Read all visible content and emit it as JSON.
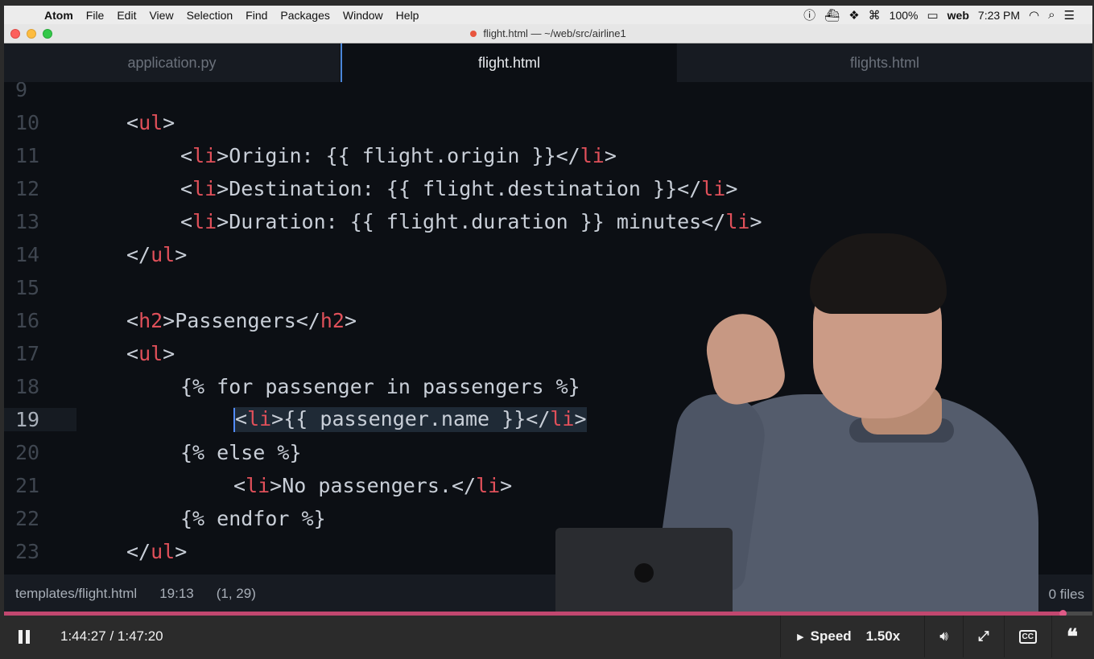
{
  "menubar": {
    "app": "Atom",
    "items": [
      "File",
      "Edit",
      "View",
      "Selection",
      "Find",
      "Packages",
      "Window",
      "Help"
    ],
    "battery": "100%",
    "user": "web",
    "clock": "7:23 PM"
  },
  "window": {
    "title": "flight.html — ~/web/src/airline1"
  },
  "tabs": [
    {
      "label": "application.py"
    },
    {
      "label": "flight.html"
    },
    {
      "label": "flights.html"
    }
  ],
  "editor": {
    "lines": [
      {
        "num": "9"
      },
      {
        "num": "10"
      },
      {
        "num": "11"
      },
      {
        "num": "12"
      },
      {
        "num": "13"
      },
      {
        "num": "14"
      },
      {
        "num": "15"
      },
      {
        "num": "16"
      },
      {
        "num": "17"
      },
      {
        "num": "18"
      },
      {
        "num": "19"
      },
      {
        "num": "20"
      },
      {
        "num": "21"
      },
      {
        "num": "22"
      },
      {
        "num": "23"
      }
    ],
    "code": {
      "l10": "<ul>",
      "l11_text": "Origin: {{ flight.origin }}",
      "l12_text": "Destination: {{ flight.destination }}",
      "l13_text": "Duration: {{ flight.duration }} minutes",
      "l14": "</ul>",
      "l16_text": "Passengers",
      "l17": "<ul>",
      "l18": "{% for passenger in passengers %}",
      "l19_text": "{{ passenger.name }}",
      "l20": "{% else %}",
      "l21_text": "No passengers.",
      "l22": "{% endfor %}",
      "l23": "</ul>"
    }
  },
  "statusbar": {
    "path": "templates/flight.html",
    "cursor": "19:13",
    "selection": "(1, 29)",
    "files": "0 files"
  },
  "player": {
    "time": "1:44:27 / 1:47:20",
    "progress": 0.973,
    "speed_label": "Speed",
    "speed_value": "1.50x",
    "cc_label": "CC",
    "accent": "#c2476f"
  }
}
